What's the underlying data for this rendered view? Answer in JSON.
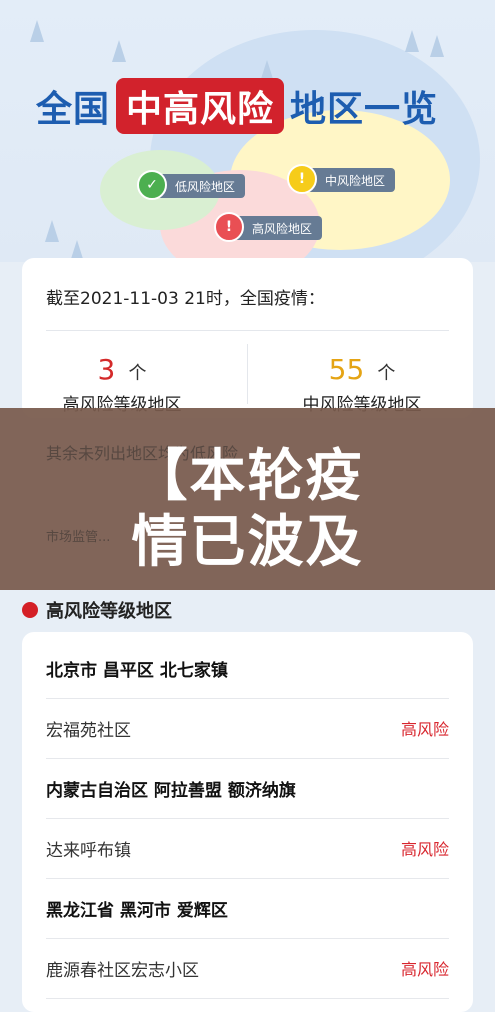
{
  "header": {
    "title_part1": "全国",
    "title_part2": "中高风险",
    "title_part3": "地区一览",
    "legend": [
      {
        "label": "低风险地区",
        "icon": "check-icon",
        "color": "#4caf50"
      },
      {
        "label": "中风险地区",
        "icon": "exclamation-icon",
        "color": "#f6cc1a"
      },
      {
        "label": "高风险地区",
        "icon": "exclamation-icon",
        "color": "#e94f54"
      }
    ]
  },
  "summary": {
    "date_line": "截至2021-11-03 21时，全国疫情：",
    "high": {
      "count": "3",
      "unit": "个",
      "label": "高风险等级地区",
      "color": "#d42a2a"
    },
    "medium": {
      "count": "55",
      "unit": "个",
      "label": "中风险等级地区",
      "color": "#e5a414"
    }
  },
  "obscured": {
    "line1": "其余未列出地区均为低风险",
    "line2": "市场监管..."
  },
  "overlay": {
    "line1": "【本轮疫",
    "line2": "情已波及"
  },
  "section": {
    "title": "高风险等级地区"
  },
  "list": [
    {
      "type": "region",
      "text": "北京市 昌平区 北七家镇"
    },
    {
      "type": "area",
      "text": "宏福苑社区",
      "risk": "高风险"
    },
    {
      "type": "region",
      "text": "内蒙古自治区 阿拉善盟 额济纳旗"
    },
    {
      "type": "area",
      "text": "达来呼布镇",
      "risk": "高风险"
    },
    {
      "type": "region",
      "text": "黑龙江省 黑河市 爱辉区"
    },
    {
      "type": "area",
      "text": "鹿源春社区宏志小区",
      "risk": "高风险"
    }
  ]
}
